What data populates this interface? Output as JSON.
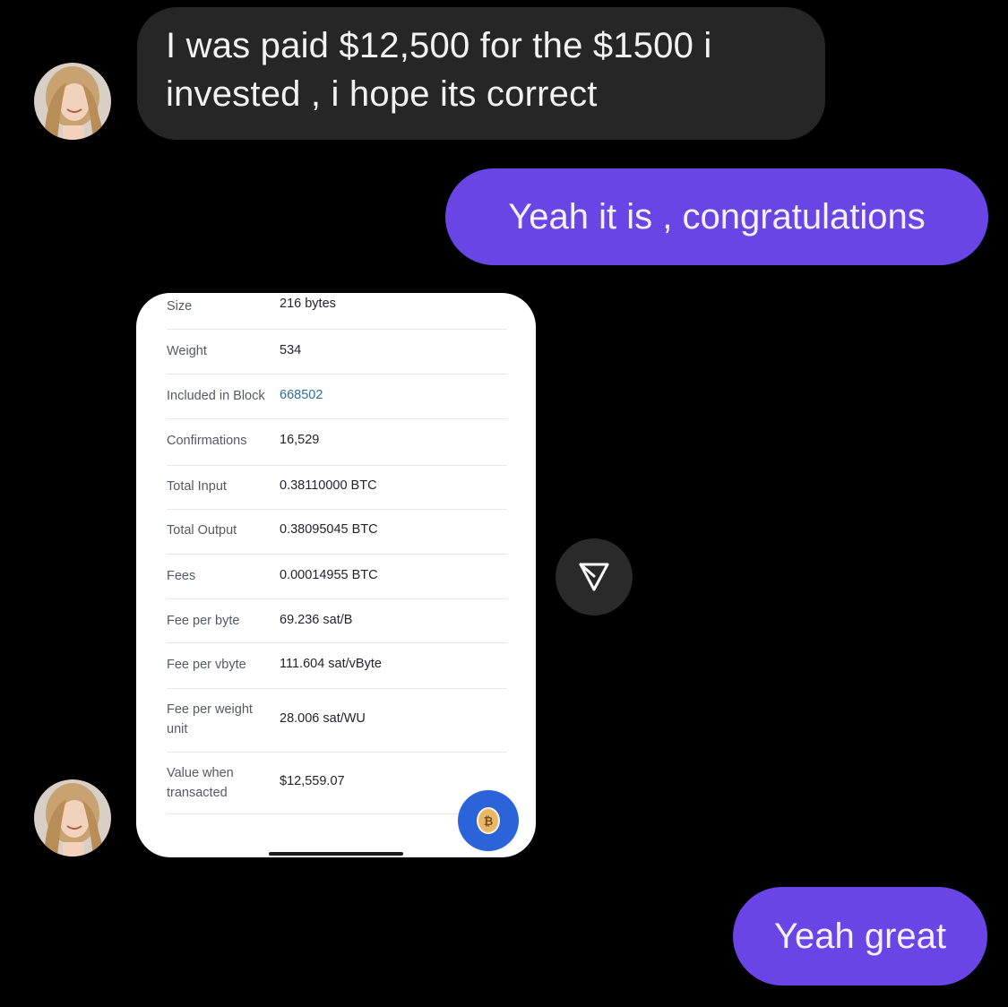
{
  "messages": {
    "incoming_1": {
      "line1": "I was paid $12,500 for the $1500 i",
      "line2": "invested , i hope its correct"
    },
    "outgoing_1": "Yeah it is , congratulations",
    "outgoing_2": "Yeah great"
  },
  "transaction_card": {
    "rows": [
      {
        "label": "Size",
        "value": "216 bytes"
      },
      {
        "label": "Weight",
        "value": "534"
      },
      {
        "label": "Included in Block",
        "value": "668502"
      },
      {
        "label": "Confirmations",
        "value": "16,529"
      },
      {
        "label": "Total Input",
        "value": "0.38110000 BTC"
      },
      {
        "label": "Total Output",
        "value": "0.38095045 BTC"
      },
      {
        "label": "Fees",
        "value": "0.00014955 BTC"
      },
      {
        "label": "Fee per byte",
        "value": "69.236 sat/B"
      },
      {
        "label": "Fee per vbyte",
        "value": "111.604 sat/vByte"
      },
      {
        "label": "Fee per weight unit",
        "value": "28.006 sat/WU"
      },
      {
        "label": "Value when transacted",
        "value": "$12,559.07"
      }
    ],
    "coin_symbol": "₿"
  },
  "icons": {
    "share": "paper-plane-icon",
    "avatar": "avatar"
  },
  "colors": {
    "background": "#000000",
    "incoming_bubble": "#262626",
    "outgoing_bubble": "#6a45e6",
    "link": "#2f6f9e",
    "coin_button": "#2b64d8"
  }
}
